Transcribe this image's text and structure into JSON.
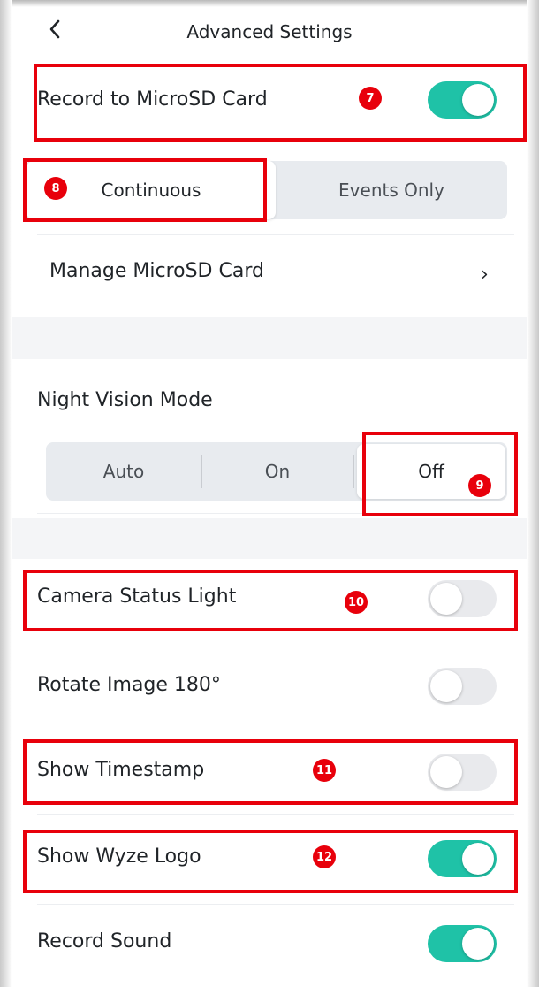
{
  "header": {
    "title": "Advanced Settings",
    "back_icon": "chevron-left-icon"
  },
  "recording": {
    "record_to_sd_label": "Record to MicroSD Card",
    "record_to_sd_on": true,
    "mode_options": [
      "Continuous",
      "Events Only"
    ],
    "mode_selected": "Continuous",
    "manage_sd_label": "Manage MicroSD Card",
    "manage_chevron": "›"
  },
  "night_vision": {
    "title": "Night Vision Mode",
    "options": [
      "Auto",
      "On",
      "Off"
    ],
    "selected": "Off"
  },
  "toggles": [
    {
      "label": "Camera Status Light",
      "on": false
    },
    {
      "label": "Rotate Image 180°",
      "on": false
    },
    {
      "label": "Show Timestamp",
      "on": false
    },
    {
      "label": "Show Wyze Logo",
      "on": true
    },
    {
      "label": "Record Sound",
      "on": true
    }
  ],
  "annotations": [
    "7",
    "8",
    "9",
    "10",
    "11",
    "12"
  ],
  "colors": {
    "toggle_on": "#1fc2a7",
    "toggle_off": "#e9eaed",
    "annotation_red": "#e8000b"
  }
}
